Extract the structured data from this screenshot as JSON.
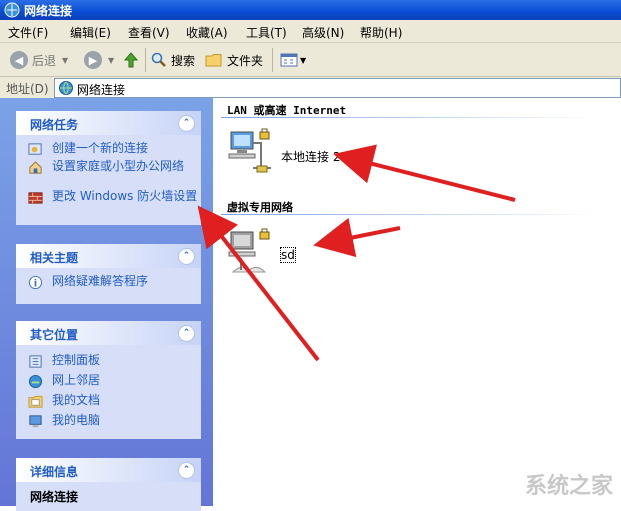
{
  "window": {
    "title": "网络连接"
  },
  "menu": [
    "文件(F)",
    "编辑(E)",
    "查看(V)",
    "收藏(A)",
    "工具(T)",
    "高级(N)",
    "帮助(H)"
  ],
  "toolbar": {
    "back": "后退",
    "search": "搜索",
    "folders": "文件夹"
  },
  "address": {
    "label": "地址(D)",
    "value": "网络连接"
  },
  "panels": {
    "network_tasks": {
      "title": "网络任务",
      "items": [
        "创建一个新的连接",
        "设置家庭或小型办公网络",
        "更改 Windows 防火墙设置"
      ]
    },
    "related": {
      "title": "相关主题",
      "items": [
        "网络疑难解答程序"
      ]
    },
    "other": {
      "title": "其它位置",
      "items": [
        "控制面板",
        "网上邻居",
        "我的文档",
        "我的电脑"
      ]
    },
    "details": {
      "title": "详细信息",
      "items": [
        "网络连接"
      ]
    }
  },
  "groups": [
    {
      "title": "LAN 或高速 Internet",
      "connections": [
        "本地连接 2"
      ]
    },
    {
      "title": "虚拟专用网络",
      "connections": [
        "sd"
      ]
    }
  ],
  "watermark": "系统之家",
  "colors": {
    "title_bar": "#0a4bd2",
    "task_pane": "#6f8de0",
    "link": "#215dc6",
    "arrow": "#e02020"
  }
}
